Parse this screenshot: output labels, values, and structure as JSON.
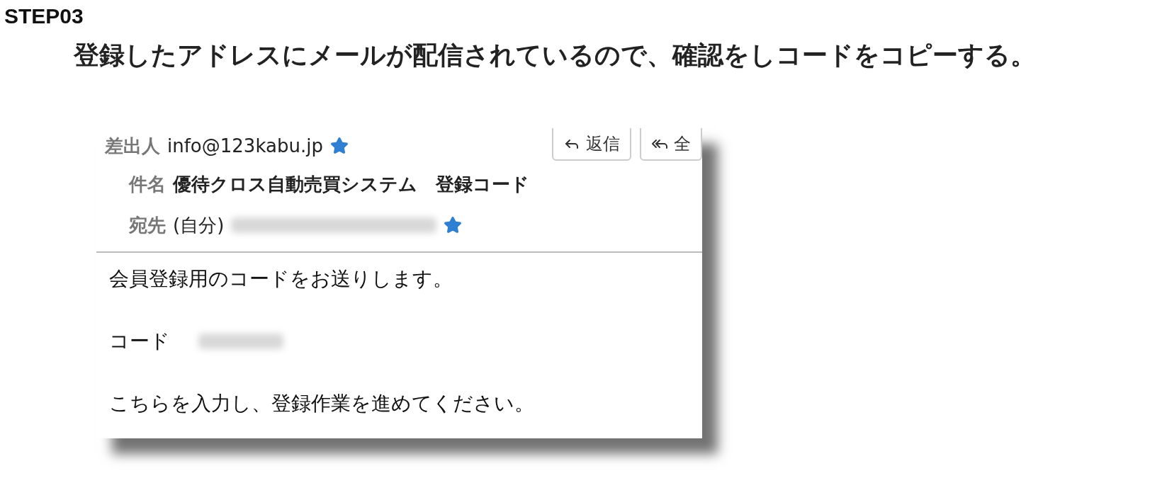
{
  "heading": "STEP03",
  "instruction": "登録したアドレスにメールが配信されているので、確認をしコードをコピーする。",
  "email": {
    "from_label": "差出人",
    "from": "info@123kabu.jp",
    "buttons": [
      {
        "kind": "reply",
        "label": "返信"
      },
      {
        "kind": "reply-all",
        "label": "全"
      }
    ],
    "subject_label": "件名",
    "subject": "優待クロス自動売買システム　登録コード",
    "to_label": "宛先",
    "to": "(自分)",
    "body": [
      {
        "kind": "text",
        "text": "会員登録用のコードをお送りします。"
      },
      {
        "kind": "code",
        "label": "コード"
      },
      {
        "kind": "text",
        "text": "こちらを入力し、登録作業を進めてください。"
      }
    ]
  }
}
